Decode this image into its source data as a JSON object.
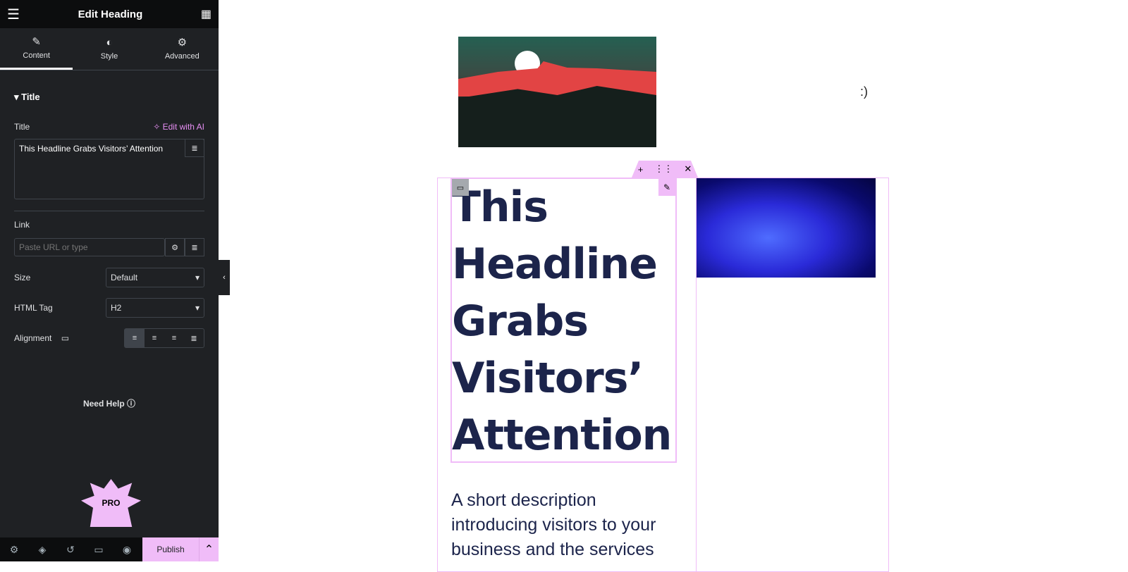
{
  "header": {
    "title": "Edit Heading",
    "menu_icon": "hamburger-icon",
    "apps_icon": "grid-icon"
  },
  "tabs": [
    {
      "label": "Content",
      "icon": "pencil-icon"
    },
    {
      "label": "Style",
      "icon": "contrast-icon"
    },
    {
      "label": "Advanced",
      "icon": "gear-icon"
    }
  ],
  "section": {
    "title": "Title"
  },
  "fields": {
    "title_label": "Title",
    "edit_ai": "Edit with AI",
    "title_value": "This Headline Grabs Visitors’ Attention",
    "link_label": "Link",
    "link_placeholder": "Paste URL or type",
    "size_label": "Size",
    "size_value": "Default",
    "tag_label": "HTML Tag",
    "tag_value": "H2",
    "alignment_label": "Alignment"
  },
  "help": "Need Help",
  "promo": {
    "badge": "PRO"
  },
  "footer": {
    "publish": "Publish"
  },
  "canvas": {
    "smiley": ":)",
    "heading": "This Headline Grabs Visitors’ Attention",
    "description": "A short description introducing visitors to your business and the services"
  },
  "colors": {
    "accent": "#f0bcf8",
    "heading": "#1c244b",
    "panel": "#1f2124"
  }
}
